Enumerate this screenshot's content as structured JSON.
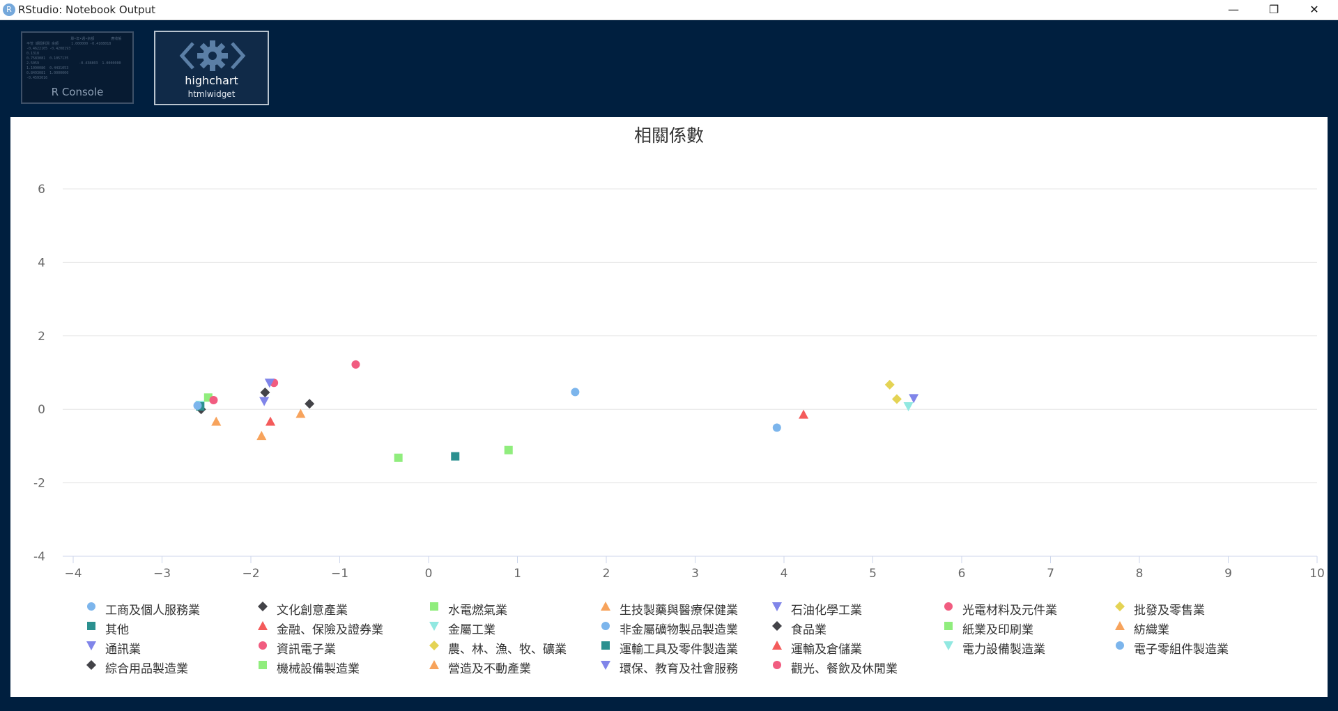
{
  "window": {
    "title": "RStudio: Notebook Output",
    "app_icon_letter": "R",
    "minimize_glyph": "—",
    "maximize_glyph": "❐",
    "close_glyph": "✕"
  },
  "thumbnails": {
    "console": {
      "label": "R Console",
      "preview_lines": [
        "                     單•年•週•余額        應收帳",
        "平管 期間利潤 余額      1.000000 -0.4108018",
        "-0.4622105 -0.4208193",
        "0.1318",
        "0.7583081  0.1057135",
        "2.5059                   -0.438803  1.0000000",
        "1.1090086  0.4431053",
        "0.8493081  1.0000000",
        "-0.4593016"
      ]
    },
    "widget": {
      "label": "highchart",
      "sublabel": "htmlwidget"
    }
  },
  "colors": {
    "window_bg": "#001f3f",
    "grid": "#e6e6e6",
    "axis_line": "#ccd6eb",
    "tick_text": "#666666",
    "title_text": "#333333"
  },
  "chart_data": {
    "type": "scatter",
    "title": "相關係數",
    "xlim": [
      -4,
      10
    ],
    "ylim": [
      -4,
      6
    ],
    "x_ticks": [
      -4,
      -3,
      -2,
      -1,
      0,
      1,
      2,
      3,
      4,
      5,
      6,
      7,
      8,
      9,
      10
    ],
    "y_ticks": [
      -4,
      -2,
      0,
      2,
      4,
      6
    ],
    "grid": "horizontal",
    "legend_placement": "bottom",
    "series": [
      {
        "name": "工商及個人服務業",
        "color": "#7cb5ec",
        "marker": "circle",
        "points": [
          [
            1.65,
            0.47
          ]
        ]
      },
      {
        "name": "文化創意產業",
        "color": "#434348",
        "marker": "diamond",
        "points": [
          [
            -1.84,
            0.46
          ]
        ]
      },
      {
        "name": "水電燃氣業",
        "color": "#90ed7d",
        "marker": "square",
        "points": [
          [
            -0.34,
            -1.32
          ]
        ]
      },
      {
        "name": "生技製藥與醫療保健業",
        "color": "#f7a35c",
        "marker": "triangle",
        "points": [
          [
            -1.88,
            -0.72
          ]
        ]
      },
      {
        "name": "石油化學工業",
        "color": "#8085e9",
        "marker": "triangle-down",
        "points": [
          [
            -1.85,
            0.22
          ]
        ]
      },
      {
        "name": "光電材料及元件業",
        "color": "#f15c80",
        "marker": "circle",
        "points": [
          [
            -1.74,
            0.72
          ]
        ]
      },
      {
        "name": "批發及零售業",
        "color": "#e4d354",
        "marker": "diamond",
        "points": [
          [
            5.19,
            0.67
          ]
        ]
      },
      {
        "name": "其他",
        "color": "#2b908f",
        "marker": "square",
        "points": [
          [
            0.3,
            -1.28
          ]
        ]
      },
      {
        "name": "金融、保險及證券業",
        "color": "#f45b5b",
        "marker": "triangle",
        "points": [
          [
            -1.78,
            -0.33
          ]
        ]
      },
      {
        "name": "金屬工業",
        "color": "#91e8e1",
        "marker": "triangle-down",
        "points": [
          [
            -2.57,
            0.12
          ]
        ]
      },
      {
        "name": "非金屬礦物製品製造業",
        "color": "#7cb5ec",
        "marker": "circle",
        "points": [
          [
            3.92,
            -0.5
          ]
        ]
      },
      {
        "name": "食品業",
        "color": "#434348",
        "marker": "diamond",
        "points": [
          [
            -2.56,
            0.0
          ]
        ]
      },
      {
        "name": "紙業及印刷業",
        "color": "#90ed7d",
        "marker": "square",
        "points": [
          [
            -2.48,
            0.32
          ]
        ]
      },
      {
        "name": "紡織業",
        "color": "#f7a35c",
        "marker": "triangle",
        "points": [
          [
            -2.39,
            -0.33
          ]
        ]
      },
      {
        "name": "通訊業",
        "color": "#8085e9",
        "marker": "triangle-down",
        "points": [
          [
            -1.79,
            0.72
          ]
        ]
      },
      {
        "name": "資訊電子業",
        "color": "#f15c80",
        "marker": "circle",
        "points": [
          [
            -2.42,
            0.25
          ]
        ]
      },
      {
        "name": "農、林、漁、牧、礦業",
        "color": "#e4d354",
        "marker": "diamond",
        "points": [
          [
            5.27,
            0.28
          ]
        ]
      },
      {
        "name": "運輸工具及零件製造業",
        "color": "#2b908f",
        "marker": "square",
        "points": [
          [
            -2.57,
            0.08
          ]
        ]
      },
      {
        "name": "運輸及倉儲業",
        "color": "#f45b5b",
        "marker": "triangle",
        "points": [
          [
            4.22,
            -0.14
          ]
        ]
      },
      {
        "name": "電力設備製造業",
        "color": "#91e8e1",
        "marker": "triangle-down",
        "points": [
          [
            5.4,
            0.08
          ]
        ]
      },
      {
        "name": "電子零組件製造業",
        "color": "#7cb5ec",
        "marker": "circle",
        "points": [
          [
            -2.6,
            0.1
          ]
        ]
      },
      {
        "name": "綜合用品製造業",
        "color": "#434348",
        "marker": "diamond",
        "points": [
          [
            -1.34,
            0.15
          ]
        ]
      },
      {
        "name": "機械設備製造業",
        "color": "#90ed7d",
        "marker": "square",
        "points": [
          [
            0.9,
            -1.11
          ]
        ]
      },
      {
        "name": "營造及不動產業",
        "color": "#f7a35c",
        "marker": "triangle",
        "points": [
          [
            -1.44,
            -0.12
          ]
        ]
      },
      {
        "name": "環保、教育及社會服務",
        "color": "#8085e9",
        "marker": "triangle-down",
        "points": [
          [
            5.46,
            0.3
          ]
        ]
      },
      {
        "name": "觀光、餐飲及休閒業",
        "color": "#f15c80",
        "marker": "circle",
        "points": [
          [
            -0.82,
            1.22
          ]
        ]
      }
    ]
  }
}
